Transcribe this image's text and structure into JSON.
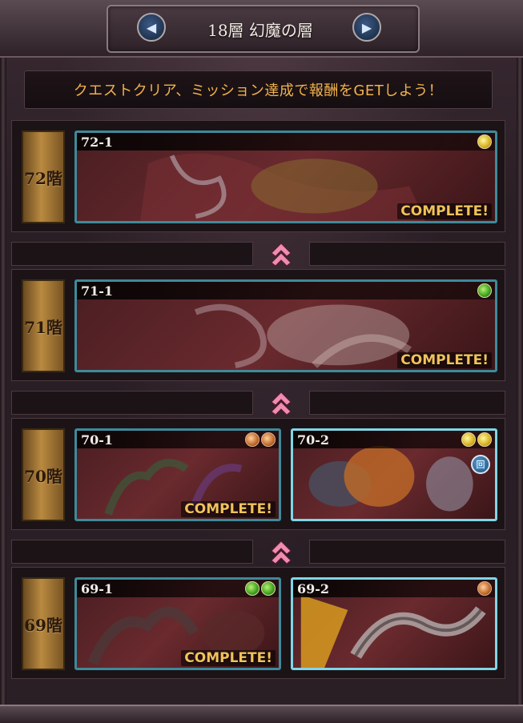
{
  "header": {
    "title": "18層 幻魔の層",
    "prev_icon": "◀",
    "next_icon": "▶"
  },
  "banner": {
    "text": "クエストクリア、ミッション達成で報酬をGETしよう！"
  },
  "floors": [
    {
      "label": "72階",
      "quests": [
        {
          "id": "72-1",
          "elements": [
            "light"
          ],
          "complete_text": "COMPLETE!"
        }
      ]
    },
    {
      "label": "71階",
      "quests": [
        {
          "id": "71-1",
          "elements": [
            "wind"
          ],
          "complete_text": "COMPLETE!"
        }
      ]
    },
    {
      "label": "70階",
      "quests": [
        {
          "id": "70-1",
          "elements": [
            "fire",
            "fire"
          ],
          "complete_text": "COMPLETE!"
        },
        {
          "id": "70-2",
          "elements": [
            "light",
            "light"
          ],
          "badge": "回"
        }
      ]
    },
    {
      "label": "69階",
      "quests": [
        {
          "id": "69-1",
          "elements": [
            "wind",
            "wind"
          ],
          "complete_text": "COMPLETE!"
        },
        {
          "id": "69-2",
          "elements": [
            "fire"
          ]
        }
      ]
    }
  ],
  "colors": {
    "complete_text": "#f0c25a",
    "banner_text": "#f1b24c",
    "card_border": "#3e8a9a",
    "card_border_active": "#7fd6e6"
  }
}
